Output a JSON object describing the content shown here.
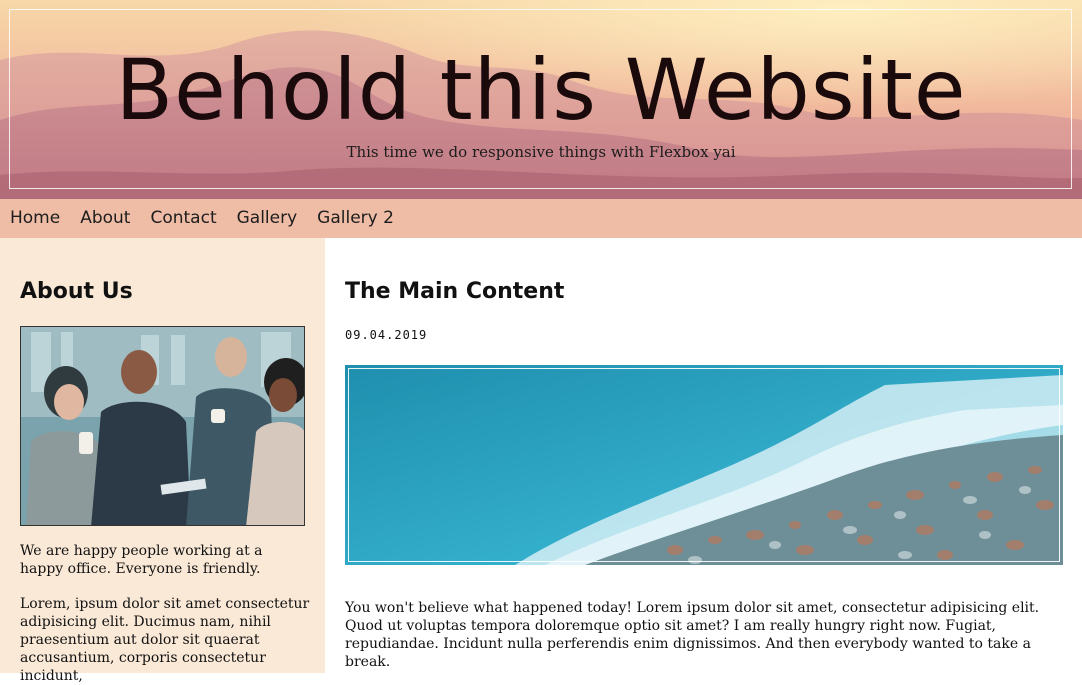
{
  "header": {
    "title": "Behold this Website",
    "subtitle": "This time we do responsive things with Flexbox yai"
  },
  "nav": {
    "items": [
      "Home",
      "About",
      "Contact",
      "Gallery",
      "Gallery 2"
    ]
  },
  "sidebar": {
    "title": "About Us",
    "image_label": "team-photo",
    "paragraphs": [
      "We are happy people working at a happy office. Everyone is friendly.",
      "Lorem, ipsum dolor sit amet consectetur adipisicing elit. Ducimus nam, nihil praesentium aut dolor sit quaerat accusantium, corporis consectetur incidunt,"
    ]
  },
  "main": {
    "title": "The Main Content",
    "date": "09.04.2019",
    "image_label": "ocean-shore-photo",
    "paragraphs": [
      "You won't believe what happened today! Lorem ipsum dolor sit amet, consectetur adipisicing elit. Quod ut voluptas tempora doloremque optio sit amet? I am really hungry right now. Fugiat, repudiandae. Incidunt nulla perferendis enim dignissimos. And then everybody wanted to take a break."
    ]
  },
  "colors": {
    "nav_bg": "#efbca6",
    "sidebar_bg": "#fae9d7",
    "header_gradient_top": "#f7d7a8",
    "header_gradient_bottom": "#ea9f96",
    "ocean": "#2aa6c4"
  }
}
